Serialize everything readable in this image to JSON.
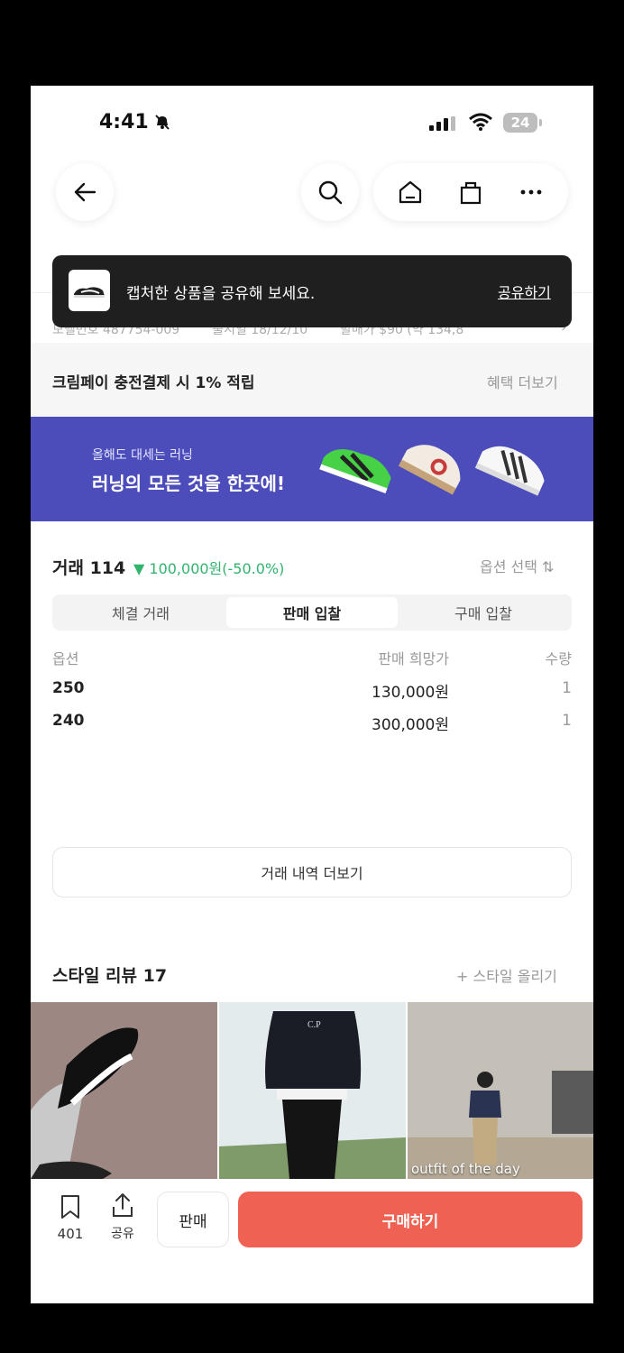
{
  "status_bar": {
    "time": "4:41",
    "battery": "24"
  },
  "product_info": {
    "model_no": "모델번호 487754-009",
    "release": "출시일 18/12/10",
    "price": "발매가 $90 (약 134,8"
  },
  "toast": {
    "message": "캡처한 상품을 공유해 보세요.",
    "action": "공유하기"
  },
  "benefit": {
    "text": "크림페이 충전결제 시 1% 적립",
    "more": "혜택 더보기"
  },
  "banner": {
    "subtitle": "올해도 대세는 러닝",
    "title": "러닝의 모든 것을 한곳에!"
  },
  "trade": {
    "title": "거래 114",
    "change": "▼ 100,000원(-50.0%)",
    "option_select": "옵션 선택 ⇅",
    "tabs": [
      {
        "label": "체결 거래",
        "active": false
      },
      {
        "label": "판매 입찰",
        "active": true
      },
      {
        "label": "구매 입찰",
        "active": false
      }
    ],
    "columns": [
      "옵션",
      "판매 희망가",
      "수량"
    ],
    "rows": [
      {
        "option": "250",
        "price": "130,000원",
        "qty": "1"
      },
      {
        "option": "240",
        "price": "300,000원",
        "qty": "1"
      }
    ],
    "history_button": "거래 내역 더보기"
  },
  "reviews": {
    "title": "스타일 리뷰 17",
    "upload": "+ 스타일 올리기",
    "photo_caption": "outfit of the day"
  },
  "bottom_bar": {
    "bookmark_count": "401",
    "share_label": "공유",
    "sell_label": "판매",
    "buy_label": "구매하기"
  },
  "colors": {
    "buy_button": "#ef6253",
    "banner_bg": "#4c4dbb",
    "price_down": "#31b46e"
  }
}
